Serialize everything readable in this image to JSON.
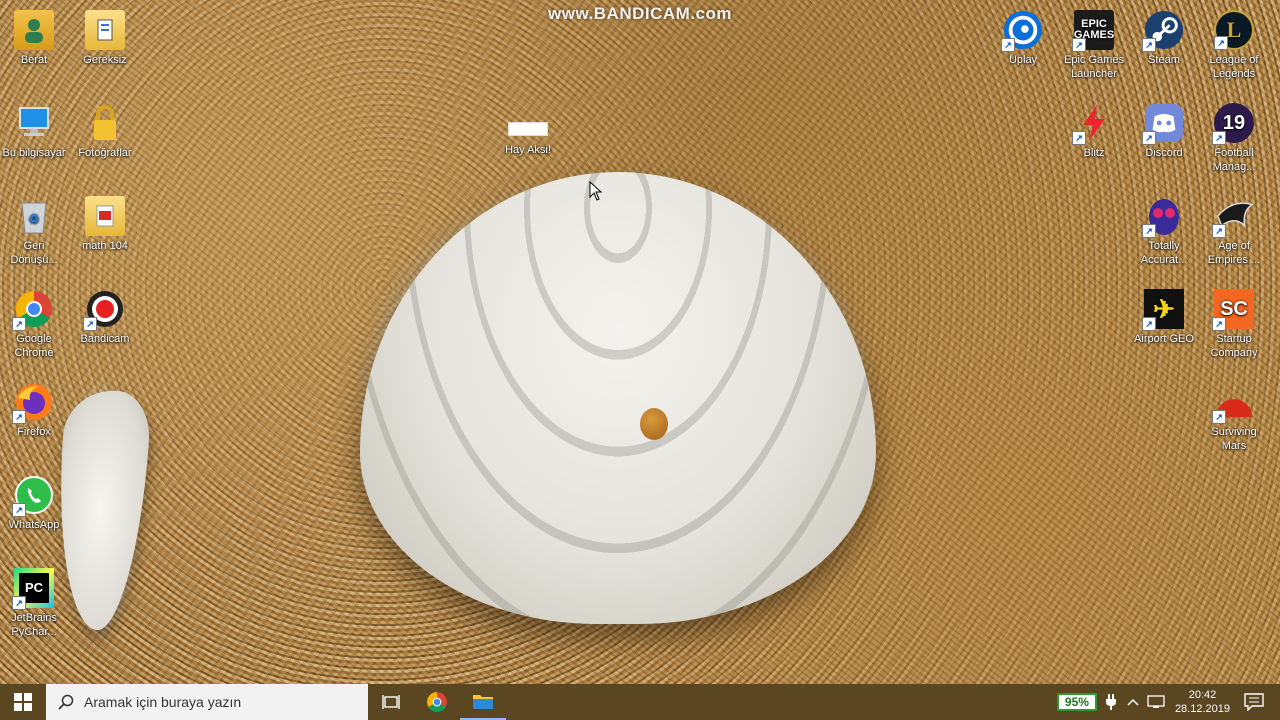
{
  "watermark": "www.BANDICAM.com",
  "desktop_icons_left": [
    {
      "label": "Berat",
      "icon": "user-folder-icon"
    },
    {
      "label": "Gereksiz",
      "icon": "folder-icon"
    },
    {
      "label": "Bu bilgisayar",
      "icon": "this-pc-icon"
    },
    {
      "label": "Fotoğraflar",
      "icon": "locked-folder-icon"
    },
    {
      "label": "Geri\nDönüşü...",
      "icon": "recycle-bin-icon"
    },
    {
      "label": "math 104",
      "icon": "pdf-folder-icon"
    },
    {
      "label": "Google\nChrome",
      "icon": "chrome-icon"
    },
    {
      "label": "Bandicam",
      "icon": "bandicam-icon"
    },
    {
      "label": "Firefox",
      "icon": "firefox-icon"
    },
    {
      "label": "WhatsApp",
      "icon": "whatsapp-icon"
    },
    {
      "label": "JetBrains\nPyChar...",
      "icon": "pycharm-icon"
    }
  ],
  "desktop_icon_middle": {
    "label": "Hay Aksi!",
    "icon": "blank-file-icon"
  },
  "desktop_icons_right": [
    {
      "label": "Uplay",
      "icon": "uplay-icon"
    },
    {
      "label": "Epic Games\nLauncher",
      "icon": "epic-games-icon",
      "badge": "EPIC\nGAMES"
    },
    {
      "label": "Steam",
      "icon": "steam-icon"
    },
    {
      "label": "League of\nLegends",
      "icon": "league-icon",
      "badge": "L"
    },
    {
      "label": "Blitz",
      "icon": "blitz-icon"
    },
    {
      "label": "Discord",
      "icon": "discord-icon"
    },
    {
      "label": "Football\nManag...",
      "icon": "football-manager-icon",
      "badge": "19"
    },
    {
      "label": "Totally\nAccurat...",
      "icon": "totally-accurate-icon"
    },
    {
      "label": "Age of\nEmpires ...",
      "icon": "age-of-empires-icon"
    },
    {
      "label": "Airport GEO",
      "icon": "airport-geo-icon",
      "badge": "✈"
    },
    {
      "label": "Startup\nCompany",
      "icon": "startup-company-icon",
      "badge": "SC"
    },
    {
      "label": "Surviving\nMars",
      "icon": "surviving-mars-icon"
    }
  ],
  "taskbar": {
    "search_placeholder": "Aramak için buraya yazın",
    "battery": "95%",
    "time": "20:42",
    "date": "28.12.2019"
  }
}
